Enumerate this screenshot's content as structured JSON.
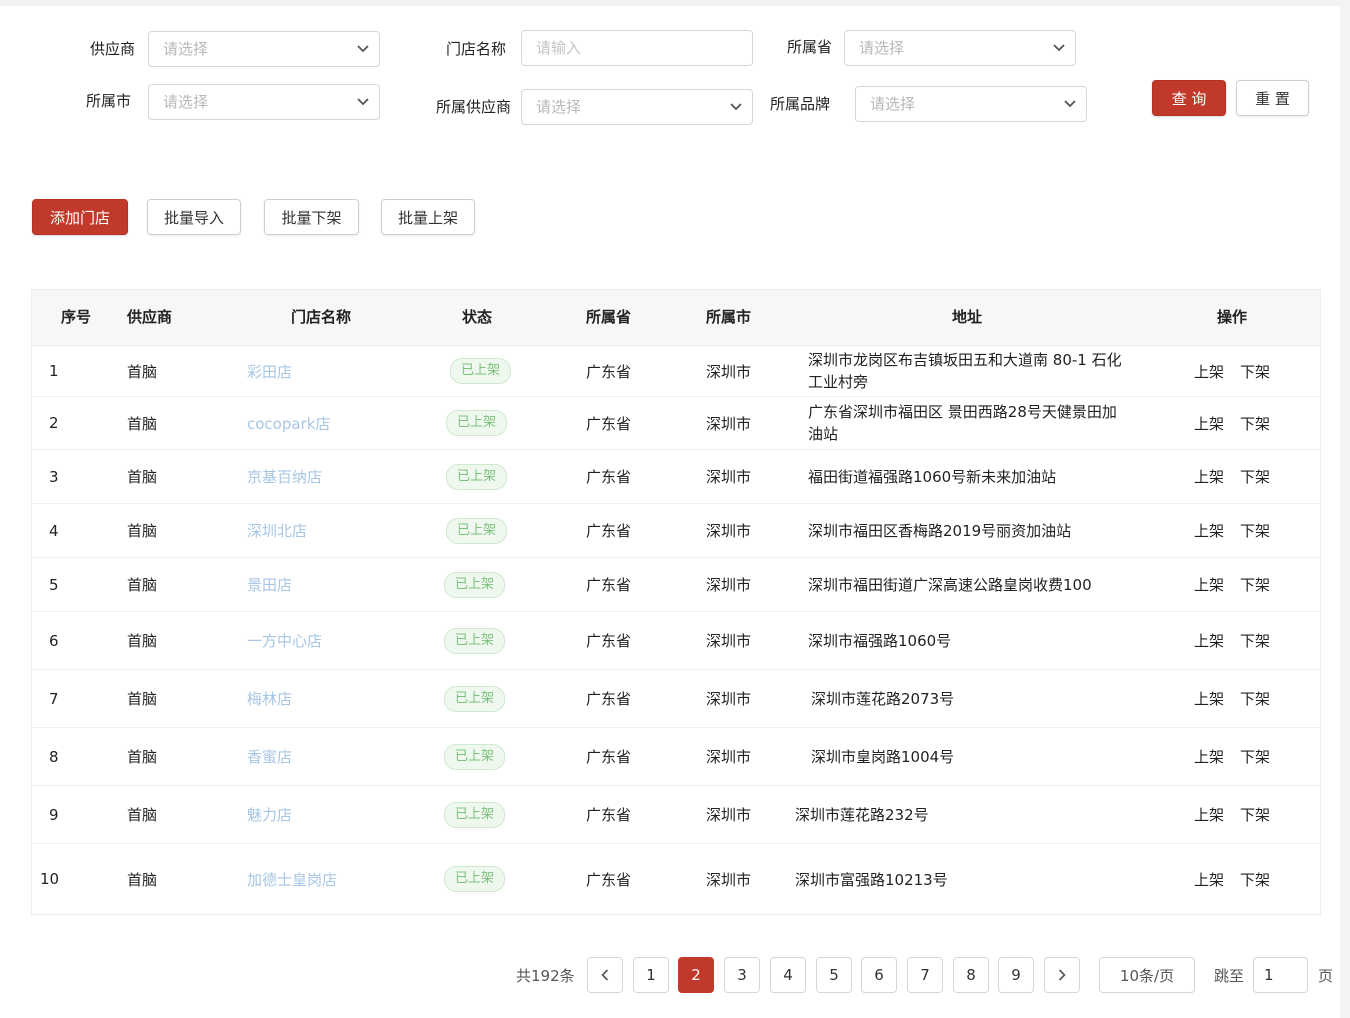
{
  "filters": {
    "supplier": {
      "label": "供应商",
      "value": "请选择"
    },
    "store_name": {
      "label": "门店名称",
      "placeholder": "请输入"
    },
    "province": {
      "label": "所属省",
      "value": "请选择"
    },
    "city": {
      "label": "所属市",
      "value": "请选择"
    },
    "owner_supplier": {
      "label": "所属供应商",
      "value": "请选择"
    },
    "brand": {
      "label": "所属品牌",
      "value": "请选择"
    },
    "query_label": "查 询",
    "reset_label": "重 置"
  },
  "actions": {
    "add_store": "添加门店",
    "batch_import": "批量导入",
    "batch_offline": "批量下架",
    "batch_online": "批量上架"
  },
  "table": {
    "headers": {
      "index": "序号",
      "supplier": "供应商",
      "store": "门店名称",
      "status": "状态",
      "province": "所属省",
      "city": "所属市",
      "address": "地址",
      "ops": "操作"
    },
    "op_online": "上架",
    "op_offline": "下架",
    "rows": [
      {
        "index": "1",
        "supplier": "首脑",
        "store": "彩田店",
        "status": "已上架",
        "province": "广东省",
        "city": "深圳市",
        "address": "深圳市龙岗区布吉镇坂田五和大道南 80-1 石化工业村旁"
      },
      {
        "index": "2",
        "supplier": "首脑",
        "store": "cocopark店",
        "status": "已上架",
        "province": "广东省",
        "city": "深圳市",
        "address": "广东省深圳市福田区  景田西路28号天健景田加油站"
      },
      {
        "index": "3",
        "supplier": "首脑",
        "store": "京基百纳店",
        "status": "已上架",
        "province": "广东省",
        "city": "深圳市",
        "address": "福田街道福强路1060号新未来加油站"
      },
      {
        "index": "4",
        "supplier": "首脑",
        "store": "深圳北店",
        "status": "已上架",
        "province": "广东省",
        "city": "深圳市",
        "address": "深圳市福田区香梅路2019号丽资加油站"
      },
      {
        "index": "5",
        "supplier": "首脑",
        "store": "景田店",
        "status": "已上架",
        "province": "广东省",
        "city": "深圳市",
        "address": "深圳市福田街道广深高速公路皇岗收费100"
      },
      {
        "index": "6",
        "supplier": "首脑",
        "store": "一方中心店",
        "status": "已上架",
        "province": "广东省",
        "city": "深圳市",
        "address": "深圳市福强路1060号"
      },
      {
        "index": "7",
        "supplier": "首脑",
        "store": "梅林店",
        "status": "已上架",
        "province": "广东省",
        "city": "深圳市",
        "address": "深圳市莲花路2073号"
      },
      {
        "index": "8",
        "supplier": "首脑",
        "store": "香蜜店",
        "status": "已上架",
        "province": "广东省",
        "city": "深圳市",
        "address": "深圳市皇岗路1004号"
      },
      {
        "index": "9",
        "supplier": "首脑",
        "store": "魅力店",
        "status": "已上架",
        "province": "广东省",
        "city": "深圳市",
        "address": "深圳市莲花路232号"
      },
      {
        "index": "10",
        "supplier": "首脑",
        "store": "加德士皇岗店",
        "status": "已上架",
        "province": "广东省",
        "city": "深圳市",
        "address": "深圳市富强路10213号"
      }
    ]
  },
  "pagination": {
    "total": "共192条",
    "prev": "<",
    "next": ">",
    "pages": [
      "1",
      "2",
      "3",
      "4",
      "5",
      "6",
      "7",
      "8",
      "9"
    ],
    "current": "2",
    "page_size": "10条/页",
    "jump_label": "跳至",
    "jump_value": "1",
    "jump_suffix": "页"
  },
  "colors": {
    "accent": "#c0392b",
    "link": "#a7c6e4",
    "badge_text": "#7cc07c"
  }
}
